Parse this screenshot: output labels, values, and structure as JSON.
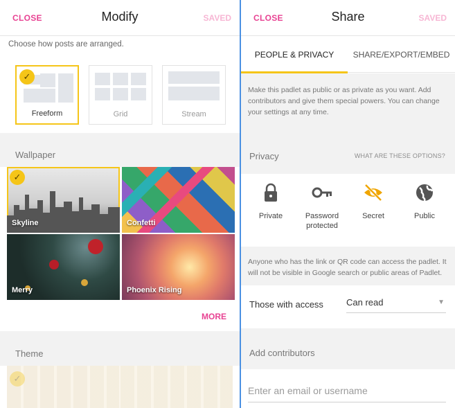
{
  "modify": {
    "close_label": "CLOSE",
    "title": "Modify",
    "saved_label": "SAVED",
    "layout_hint": "Choose how posts are arranged.",
    "layouts": [
      {
        "label": "Freeform",
        "selected": true
      },
      {
        "label": "Grid",
        "selected": false
      },
      {
        "label": "Stream",
        "selected": false
      }
    ],
    "wallpaper_title": "Wallpaper",
    "wallpapers": [
      {
        "label": "Skyline",
        "selected": true
      },
      {
        "label": "Confetti",
        "selected": false
      },
      {
        "label": "Merry",
        "selected": false
      },
      {
        "label": "Phoenix Rising",
        "selected": false
      }
    ],
    "more_label": "MORE",
    "theme_title": "Theme"
  },
  "share": {
    "close_label": "CLOSE",
    "title": "Share",
    "saved_label": "SAVED",
    "tabs": [
      {
        "label": "PEOPLE & PRIVACY",
        "active": true
      },
      {
        "label": "SHARE/EXPORT/EMBED",
        "active": false
      }
    ],
    "intro": "Make this padlet as public or as private as you want. Add contributors and give them special powers. You can change your settings at any time.",
    "privacy_label": "Privacy",
    "privacy_link": "WHAT ARE THESE OPTIONS?",
    "privacy_options": [
      {
        "label": "Private",
        "icon": "lock-icon",
        "selected": false
      },
      {
        "label": "Password protected",
        "icon": "key-icon",
        "selected": false
      },
      {
        "label": "Secret",
        "icon": "eye-off-icon",
        "selected": true
      },
      {
        "label": "Public",
        "icon": "globe-icon",
        "selected": false
      }
    ],
    "access_note": "Anyone who has the link or QR code can access the padlet. It will not be visible in Google search or public areas of Padlet.",
    "access_label": "Those with access",
    "access_value": "Can read",
    "contributors_label": "Add contributors",
    "email_placeholder": "Enter an email or username"
  },
  "colors": {
    "accent_pink": "#e84393",
    "saved_pink": "#f7b6d4",
    "selection_yellow": "#f5c518",
    "secret_orange": "#f0a500",
    "divider_blue": "#4a90e2"
  }
}
